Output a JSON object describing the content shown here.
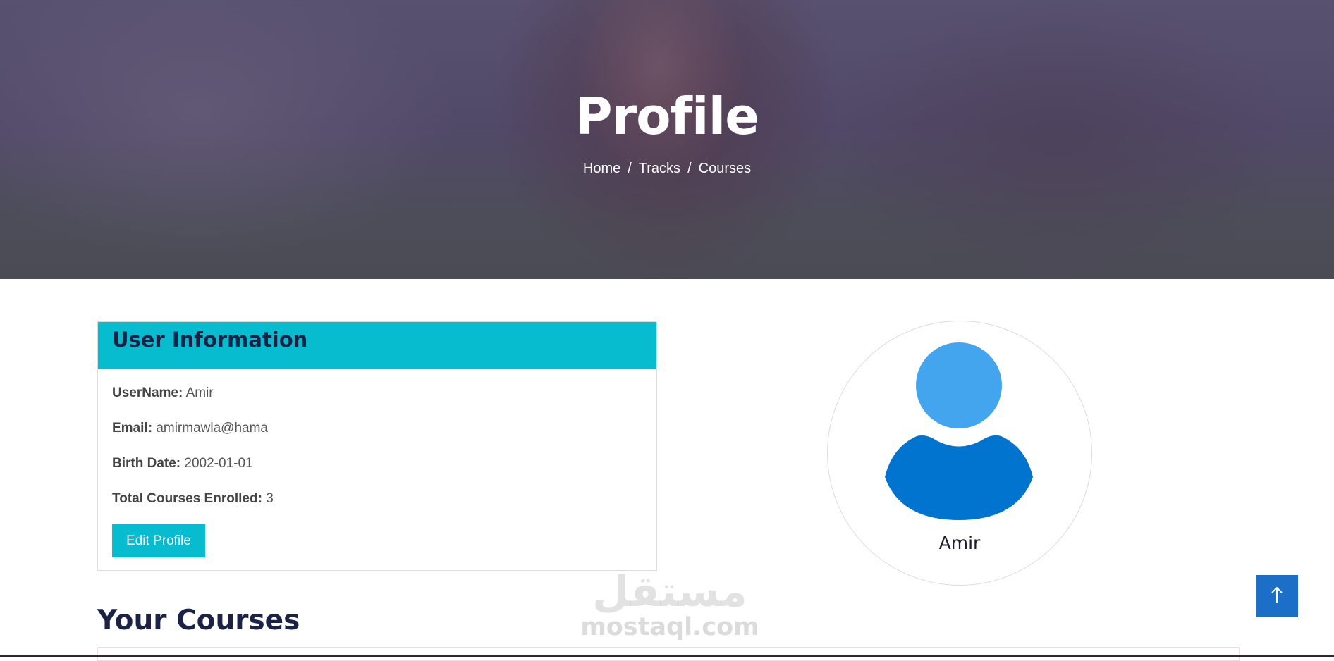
{
  "hero": {
    "title": "Profile",
    "breadcrumb": [
      {
        "label": "Home"
      },
      {
        "label": "Tracks"
      },
      {
        "label": "Courses"
      }
    ],
    "separator": "/"
  },
  "user_info": {
    "header": "User Information",
    "fields": [
      {
        "label": "UserName:",
        "value": "Amir"
      },
      {
        "label": "Email:",
        "value": "amirmawla@hama"
      },
      {
        "label": "Birth Date:",
        "value": "2002-01-01"
      },
      {
        "label": "Total Courses Enrolled:",
        "value": "3"
      }
    ],
    "edit_button": "Edit Profile"
  },
  "avatar": {
    "name": "Amir",
    "icon": "user-avatar-icon",
    "head_color": "#44a5ef",
    "body_color": "#0074cf"
  },
  "courses": {
    "title": "Your Courses"
  },
  "watermark": {
    "arabic": "مستقل",
    "latin": "mostaql.com"
  },
  "scroll_top": {
    "icon": "arrow-up-icon"
  },
  "colors": {
    "accent": "#07bccf",
    "heading": "#1c2245",
    "scroll_button": "#1b6fc7"
  }
}
